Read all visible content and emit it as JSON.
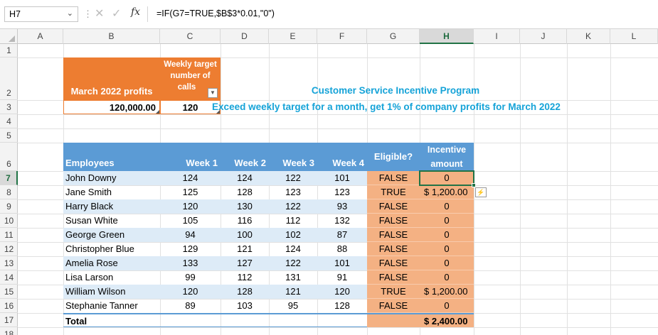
{
  "name_box": {
    "value": "H7"
  },
  "formula_bar": {
    "cancel_glyph": "✕",
    "enter_glyph": "✓",
    "fx_label": "fx",
    "formula": "=IF(G7=TRUE,$B$3*0.01,\"0\")"
  },
  "columns": [
    "A",
    "B",
    "C",
    "D",
    "E",
    "F",
    "G",
    "H",
    "I",
    "J",
    "K",
    "L"
  ],
  "selected_column": "H",
  "rows": [
    "1",
    "2",
    "3",
    "4",
    "5",
    "6",
    "7",
    "8",
    "9",
    "10",
    "11",
    "12",
    "13",
    "14",
    "15",
    "16",
    "17",
    "18"
  ],
  "selected_row": "7",
  "top_block": {
    "profits_header": "March 2022 profits",
    "target_header_lines": [
      "Weekly target",
      "number of",
      "calls"
    ],
    "profits_value": "120,000.00",
    "target_value": "120"
  },
  "program": {
    "title": "Customer Service Incentive Program",
    "subtitle": "Exceed weekly target for a month, get 1% of company profits for March 2022"
  },
  "table": {
    "headers": {
      "employees": "Employees",
      "week1": "Week 1",
      "week2": "Week 2",
      "week3": "Week 3",
      "week4": "Week 4",
      "eligible": "Eligible?",
      "incentive_lines": [
        "Incentive",
        "amount"
      ]
    },
    "rows": [
      {
        "name": "John Downy",
        "w1": "124",
        "w2": "124",
        "w3": "122",
        "w4": "101",
        "eligible": "FALSE",
        "amount": "0"
      },
      {
        "name": "Jane Smith",
        "w1": "125",
        "w2": "128",
        "w3": "123",
        "w4": "123",
        "eligible": "TRUE",
        "amount": "$ 1,200.00"
      },
      {
        "name": "Harry Black",
        "w1": "120",
        "w2": "130",
        "w3": "122",
        "w4": "93",
        "eligible": "FALSE",
        "amount": "0"
      },
      {
        "name": "Susan White",
        "w1": "105",
        "w2": "116",
        "w3": "112",
        "w4": "132",
        "eligible": "FALSE",
        "amount": "0"
      },
      {
        "name": "George Green",
        "w1": "94",
        "w2": "100",
        "w3": "102",
        "w4": "87",
        "eligible": "FALSE",
        "amount": "0"
      },
      {
        "name": "Christopher Blue",
        "w1": "129",
        "w2": "121",
        "w3": "124",
        "w4": "88",
        "eligible": "FALSE",
        "amount": "0"
      },
      {
        "name": "Amelia Rose",
        "w1": "133",
        "w2": "127",
        "w3": "122",
        "w4": "101",
        "eligible": "FALSE",
        "amount": "0"
      },
      {
        "name": "Lisa Larson",
        "w1": "99",
        "w2": "112",
        "w3": "131",
        "w4": "91",
        "eligible": "FALSE",
        "amount": "0"
      },
      {
        "name": "William Wilson",
        "w1": "120",
        "w2": "128",
        "w3": "121",
        "w4": "120",
        "eligible": "TRUE",
        "amount": "$ 1,200.00"
      },
      {
        "name": "Stephanie Tanner",
        "w1": "89",
        "w2": "103",
        "w3": "95",
        "w4": "128",
        "eligible": "FALSE",
        "amount": "0"
      }
    ],
    "total_label": "Total",
    "total_amount": "$ 2,400.00"
  },
  "colors": {
    "orange_header": "#ed7d31",
    "blue_header": "#5b9bd5",
    "band": "#ddebf7",
    "peach": "#f4b183",
    "title": "#15a3d8",
    "selection": "#217346"
  }
}
